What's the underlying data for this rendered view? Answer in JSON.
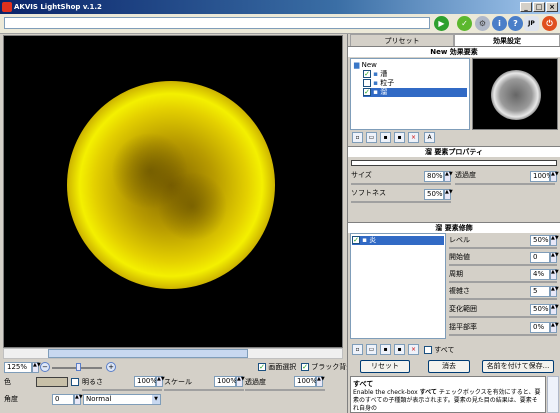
{
  "window": {
    "title": "AKVIS LightShop v.1.2"
  },
  "toolbar": {
    "path_value": "",
    "icons": [
      "run-icon",
      "apply-icon",
      "preferences-icon",
      "about-icon",
      "help-icon",
      "language-icon",
      "close-program-icon"
    ],
    "language_label": "JP"
  },
  "left": {
    "zoom_value": "125%",
    "show_selection_label": "画面選択",
    "black_bg_label": "ブラック背景",
    "color_label": "色",
    "brightness_label": "明るさ",
    "brightness_value": "100%",
    "scale_label": "スケール",
    "scale_value": "100%",
    "transparency_label": "透過度",
    "transparency_value": "100%",
    "angle_label": "角度",
    "angle_value": "0",
    "blend_mode": "Normal"
  },
  "right": {
    "tab_presets": "プリセット",
    "tab_effects": "効果設定",
    "effect_header": "New 効果要素",
    "tree_root": "New",
    "tree_items": [
      {
        "label": "漕",
        "checked": true
      },
      {
        "label": "粒子",
        "checked": false
      },
      {
        "label": "溜",
        "checked": true
      }
    ],
    "element_props_header": "溜 要素プロパティ",
    "size_label": "サイズ",
    "size_value": "80%",
    "opacity_label": "透過度",
    "opacity_value": "100%",
    "softness_label": "ソフトネス",
    "softness_value": "50%",
    "element_decor_header": "溜 要素修飾",
    "decor_item": "炎",
    "params": [
      {
        "label": "レベル",
        "value": "50%"
      },
      {
        "label": "開始値",
        "value": "0"
      },
      {
        "label": "周期",
        "value": "4%"
      },
      {
        "label": "複雑さ",
        "value": "5"
      },
      {
        "label": "変化範囲",
        "value": "50%"
      },
      {
        "label": "揺平部率",
        "value": "0%"
      }
    ],
    "all_label": "すべて",
    "reset_button": "リセット",
    "delete_button": "消去",
    "save_as_button": "名前を付けて保存...",
    "help_title": "すべて",
    "help_text_1": "Enable the check-box ",
    "help_text_bold": "すべて",
    "help_text_2": " チェックボックスを有効にすると、要素のすべての子種類が表示されます。要素の見た目の結果は、要素それ自身の"
  }
}
